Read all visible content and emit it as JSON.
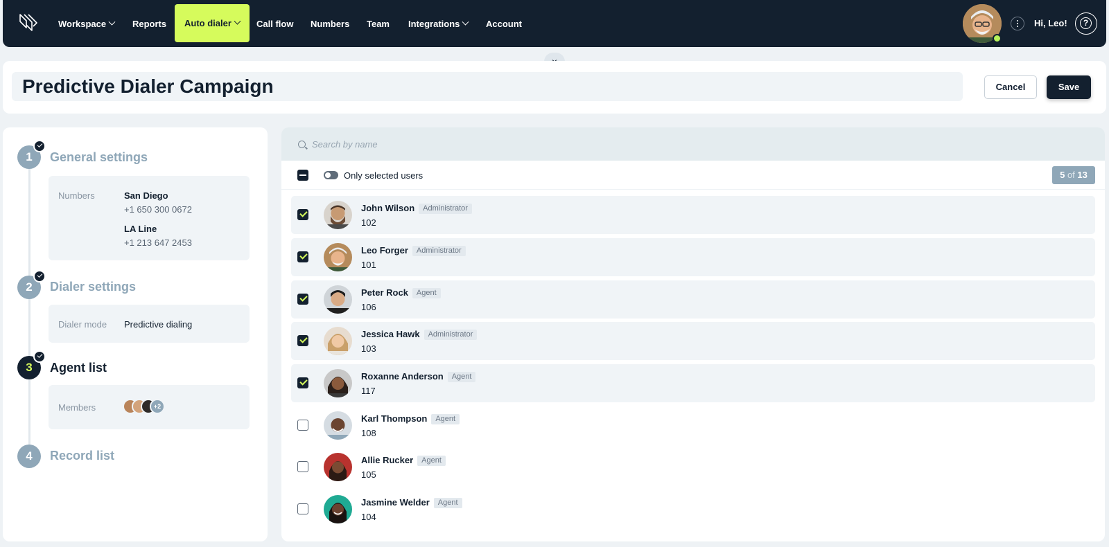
{
  "nav": {
    "items": [
      {
        "label": "Workspace",
        "dropdown": true
      },
      {
        "label": "Reports",
        "dropdown": false
      },
      {
        "label": "Auto dialer",
        "dropdown": true,
        "active": true
      },
      {
        "label": "Call flow",
        "dropdown": false
      },
      {
        "label": "Numbers",
        "dropdown": false
      },
      {
        "label": "Team",
        "dropdown": false
      },
      {
        "label": "Integrations",
        "dropdown": true
      },
      {
        "label": "Account",
        "dropdown": false
      }
    ],
    "greeting": "Hi, Leo!",
    "accent_color": "#d6fb5c",
    "bg_color": "#13202f"
  },
  "header": {
    "title": "Predictive Dialer Campaign",
    "cancel_label": "Cancel",
    "save_label": "Save",
    "close_icon": "×"
  },
  "steps": [
    {
      "number": "1",
      "title": "General settings",
      "completed": true,
      "numbers_label": "Numbers",
      "numbers": [
        {
          "name": "San Diego",
          "phone": "+1 650 300 0672"
        },
        {
          "name": "LA Line",
          "phone": "+1 213 647 2453"
        }
      ]
    },
    {
      "number": "2",
      "title": "Dialer settings",
      "completed": true,
      "mode_label": "Dialer mode",
      "mode_value": "Predictive dialing"
    },
    {
      "number": "3",
      "title": "Agent list",
      "completed": true,
      "active": true,
      "members_label": "Members",
      "members_more": "+2"
    },
    {
      "number": "4",
      "title": "Record list",
      "completed": false
    }
  ],
  "agents": {
    "search_placeholder": "Search by name",
    "toggle_label": "Only selected users",
    "count_selected": "5",
    "count_of": "of",
    "count_total": "13",
    "users": [
      {
        "name": "John Wilson",
        "role": "Administrator",
        "ext": "102",
        "selected": true
      },
      {
        "name": "Leo Forger",
        "role": "Administrator",
        "ext": "101",
        "selected": true
      },
      {
        "name": "Peter Rock",
        "role": "Agent",
        "ext": "106",
        "selected": true
      },
      {
        "name": "Jessica Hawk",
        "role": "Administrator",
        "ext": "103",
        "selected": true
      },
      {
        "name": "Roxanne Anderson",
        "role": "Agent",
        "ext": "117",
        "selected": true
      },
      {
        "name": "Karl Thompson",
        "role": "Agent",
        "ext": "108",
        "selected": false
      },
      {
        "name": "Allie Rucker",
        "role": "Agent",
        "ext": "105",
        "selected": false
      },
      {
        "name": "Jasmine Welder",
        "role": "Agent",
        "ext": "104",
        "selected": false
      }
    ]
  }
}
